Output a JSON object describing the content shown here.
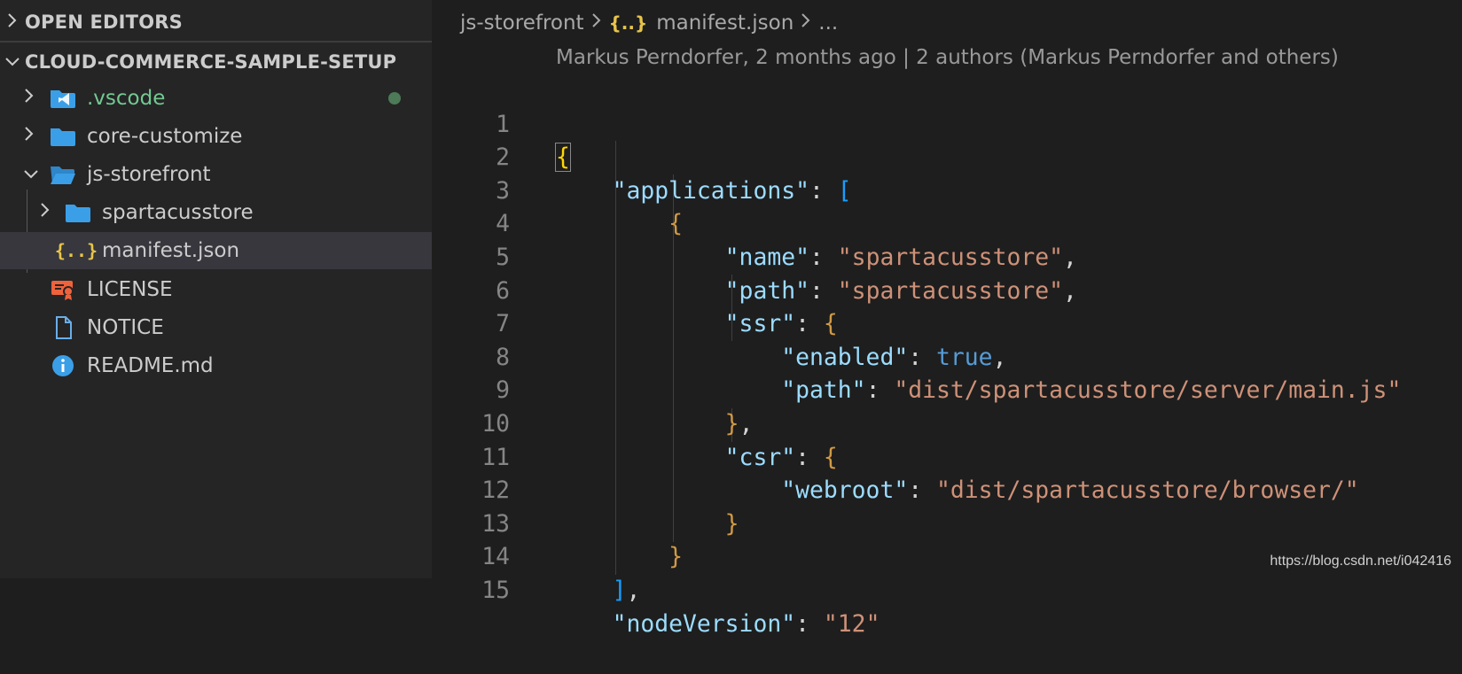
{
  "explorer": {
    "open_editors_label": "OPEN EDITORS",
    "project_label": "CLOUD-COMMERCE-SAMPLE-SETUP",
    "items": [
      {
        "label": ".vscode",
        "type": "folder",
        "expanded": false,
        "status": "modified-dot",
        "color": "#73c991"
      },
      {
        "label": "core-customize",
        "type": "folder",
        "expanded": false
      },
      {
        "label": "js-storefront",
        "type": "folder",
        "expanded": true
      },
      {
        "label": "spartacusstore",
        "type": "folder",
        "expanded": false
      },
      {
        "label": "manifest.json",
        "type": "json-file",
        "selected": true
      },
      {
        "label": "LICENSE",
        "type": "license-file"
      },
      {
        "label": "NOTICE",
        "type": "text-file"
      },
      {
        "label": "README.md",
        "type": "info-file"
      }
    ]
  },
  "editor": {
    "breadcrumb": {
      "folder": "js-storefront",
      "file_icon": "{..}",
      "file": "manifest.json",
      "more": "..."
    },
    "codelens": "Markus Perndorfer, 2 months ago | 2 authors (Markus Perndorfer and others)",
    "line_numbers": [
      "1",
      "2",
      "3",
      "4",
      "5",
      "6",
      "7",
      "8",
      "9",
      "10",
      "11",
      "12",
      "13",
      "14",
      "15"
    ],
    "code": {
      "brace_open": "{",
      "applications_key": "\"applications\"",
      "colon": ":",
      "bracket_open": "[",
      "obj_open": "{",
      "name_key": "\"name\"",
      "name_val": "\"spartacusstore\"",
      "path_key": "\"path\"",
      "path_val": "\"spartacusstore\"",
      "ssr_key": "\"ssr\"",
      "ssr_open": "{",
      "enabled_key": "\"enabled\"",
      "enabled_val": "true",
      "ssr_path_key": "\"path\"",
      "ssr_path_val": "\"dist/spartacusstore/server/main.js\"",
      "ssr_close": "}",
      "comma": ",",
      "csr_key": "\"csr\"",
      "csr_open": "{",
      "webroot_key": "\"webroot\"",
      "webroot_val": "\"dist/spartacusstore/browser/\"",
      "csr_close": "}",
      "obj_close": "}",
      "bracket_close": "]",
      "nodeversion_key": "\"nodeVersion\"",
      "nodeversion_val": "\"12\""
    }
  },
  "watermark": "https://blog.csdn.net/i042416",
  "colors": {
    "sidebar_bg": "#252526",
    "editor_bg": "#1e1e1e",
    "selection_bg": "#37373d",
    "folder_icon": "#3b9fe8",
    "json_icon": "#e8c44a",
    "license_icon": "#f0623b",
    "key": "#9cdcfe",
    "string": "#ce9178",
    "boolean": "#569cd6"
  }
}
